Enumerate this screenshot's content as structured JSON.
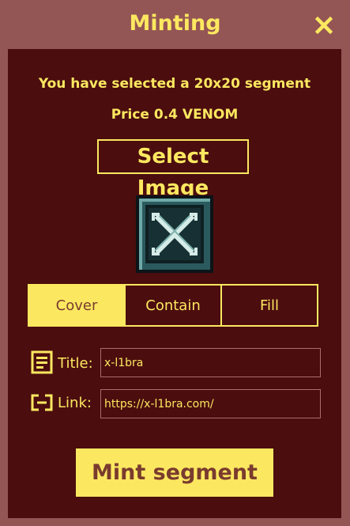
{
  "header": {
    "title": "Minting",
    "close_icon": "close-icon"
  },
  "info": {
    "selection_text": "You have selected a 20x20 segment",
    "price_text": "Price 0.4 VENOM"
  },
  "select_image": {
    "label": "Select Image"
  },
  "preview": {
    "icon": "pixel-cross-image"
  },
  "fit_modes": {
    "options": [
      "Cover",
      "Contain",
      "Fill"
    ],
    "selected": "Cover"
  },
  "form": {
    "title_label": "Title:",
    "title_value": "x-l1bra",
    "title_icon": "document-icon",
    "link_label": "Link:",
    "link_value": "https://x-l1bra.com/",
    "link_icon": "link-icon"
  },
  "mint": {
    "label": "Mint segment"
  },
  "colors": {
    "outer_background": "#945555",
    "panel_background": "#4b0d0e",
    "accent": "#fce860",
    "active_text": "#7a3b2e",
    "field_border": "#a86e6e"
  }
}
